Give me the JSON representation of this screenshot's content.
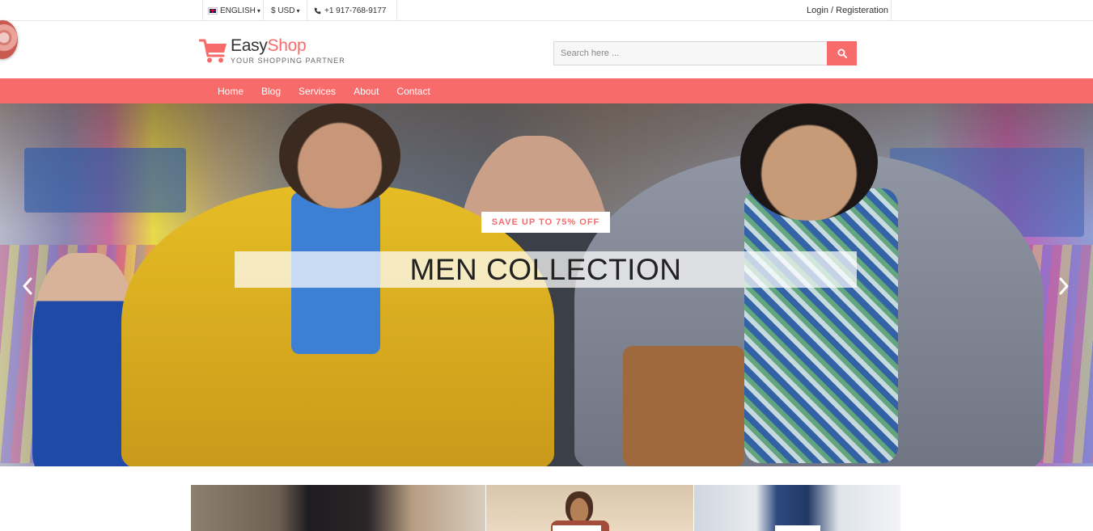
{
  "topbar": {
    "language": "ENGLISH",
    "currency": "$ USD",
    "phone": "+1 917-768-9177",
    "login": "Login / Registeration"
  },
  "brand": {
    "name_part1": "Easy",
    "name_part2": "Shop",
    "tagline": "YOUR SHOPPING PARTNER"
  },
  "search": {
    "placeholder": "Search here ..."
  },
  "nav": {
    "items": [
      "Home",
      "Blog",
      "Services",
      "About",
      "Contact"
    ]
  },
  "hero": {
    "badge": "SAVE UP TO 75% OFF",
    "title": "MEN COLLECTION"
  },
  "colors": {
    "accent": "#f76b6a",
    "text": "#333333"
  },
  "icons": [
    "uk-flag-icon",
    "caret-down-icon",
    "phone-icon",
    "cart-icon",
    "search-icon",
    "arrow-left-icon",
    "arrow-right-icon"
  ]
}
